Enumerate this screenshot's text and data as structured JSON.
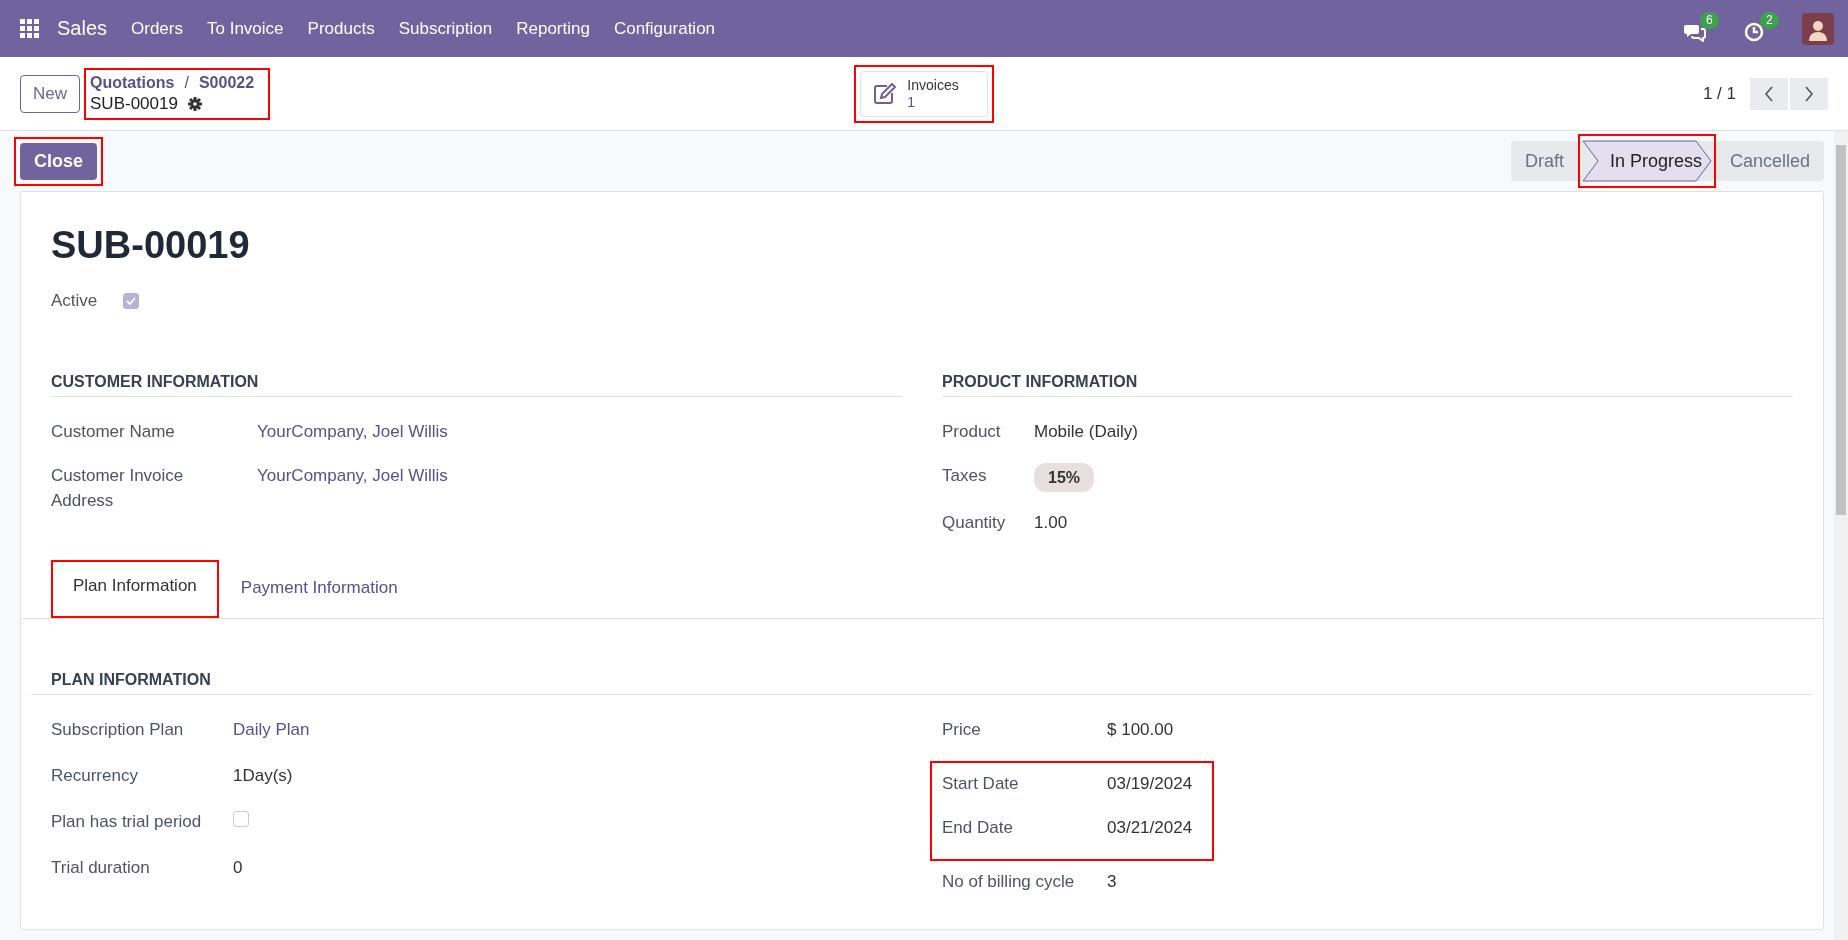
{
  "navbar": {
    "app": "Sales",
    "menu": [
      "Orders",
      "To Invoice",
      "Products",
      "Subscription",
      "Reporting",
      "Configuration"
    ],
    "badges": [
      {
        "kind": "chat",
        "count": "6"
      },
      {
        "kind": "activity",
        "count": "2"
      }
    ]
  },
  "control_panel": {
    "new_button": "New",
    "breadcrumb": {
      "highlighted": true,
      "separator": "/",
      "items": [
        "Quotations",
        "S00022"
      ],
      "current": "SUB-00019"
    },
    "smart_button": {
      "label": "Invoices",
      "count": "1",
      "highlighted": true
    },
    "pager": "1 / 1"
  },
  "actions": [
    {
      "label": "Close",
      "highlighted": true
    }
  ],
  "statusbar": [
    {
      "label": "Draft",
      "selected": false,
      "highlighted": false
    },
    {
      "label": "In Progress",
      "selected": true,
      "highlighted": true
    },
    {
      "label": "Cancelled",
      "selected": false,
      "highlighted": false
    }
  ],
  "form": {
    "title": "SUB-00019",
    "active": {
      "label": "Active",
      "checked": true
    },
    "sections": [
      {
        "title": "CUSTOMER INFORMATION",
        "fields": [
          {
            "label": "Customer Name",
            "kind": "link",
            "value": "YourCompany, Joel Willis"
          },
          {
            "label": "Customer Invoice Address",
            "kind": "link",
            "value": "YourCompany, Joel Willis"
          }
        ]
      },
      {
        "title": "PRODUCT INFORMATION",
        "fields": [
          {
            "label": "Product",
            "kind": "text",
            "value": "Mobile (Daily)"
          },
          {
            "label": "Taxes",
            "kind": "tag",
            "value": "15%"
          },
          {
            "label": "Quantity",
            "kind": "text",
            "value": "1.00"
          }
        ]
      }
    ],
    "tabs": [
      {
        "label": "Plan Information",
        "selected": true,
        "highlighted": true
      },
      {
        "label": "Payment Information",
        "selected": false,
        "highlighted": false
      }
    ],
    "plan": {
      "title": "PLAN INFORMATION",
      "left": [
        {
          "label": "Subscription Plan",
          "kind": "link",
          "value": "Daily Plan",
          "highlighted": false
        },
        {
          "label": "Recurrency",
          "kind": "text",
          "value": "1Day(s)",
          "highlighted": false
        },
        {
          "label": "Plan has trial period",
          "kind": "checkbox",
          "checked": false,
          "highlighted": false
        },
        {
          "label": "Trial duration",
          "kind": "text",
          "value": "0",
          "highlighted": false
        }
      ],
      "right": [
        {
          "label": "Price",
          "kind": "text",
          "value": "$ 100.00",
          "highlighted": false
        },
        {
          "label": "Start Date",
          "kind": "text",
          "value": "03/19/2024",
          "highlighted": true
        },
        {
          "label": "End Date",
          "kind": "text",
          "value": "03/21/2024",
          "highlighted": true
        },
        {
          "label": "No of billing cycle",
          "kind": "text",
          "value": "3",
          "highlighted": false
        }
      ]
    }
  }
}
